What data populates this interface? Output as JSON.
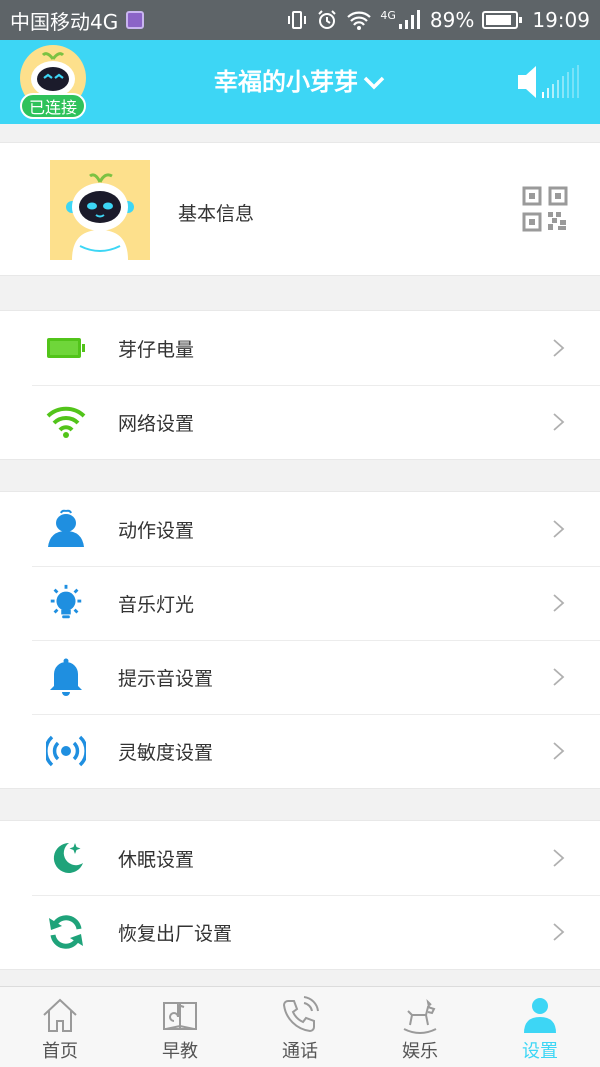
{
  "status_bar": {
    "carrier": "中国移动4G",
    "network": "4G",
    "battery_pct": "89%",
    "time": "19:09"
  },
  "header": {
    "connected_label": "已连接",
    "device_name": "幸福的小芽芽"
  },
  "profile": {
    "label": "基本信息"
  },
  "groups": [
    [
      {
        "label": "芽仔电量",
        "icon": "battery-icon",
        "color": "#52c41a"
      },
      {
        "label": "网络设置",
        "icon": "wifi-icon",
        "color": "#52c41a"
      }
    ],
    [
      {
        "label": "动作设置",
        "icon": "robot-action-icon",
        "color": "#1f8fe0"
      },
      {
        "label": "音乐灯光",
        "icon": "lightbulb-icon",
        "color": "#1f8fe0"
      },
      {
        "label": "提示音设置",
        "icon": "bell-icon",
        "color": "#1f8fe0"
      },
      {
        "label": "灵敏度设置",
        "icon": "sensitivity-icon",
        "color": "#1f8fe0"
      }
    ],
    [
      {
        "label": "休眠设置",
        "icon": "moon-icon",
        "color": "#1fa37a"
      },
      {
        "label": "恢复出厂设置",
        "icon": "refresh-icon",
        "color": "#1fa37a"
      }
    ]
  ],
  "tabs": [
    {
      "label": "首页",
      "icon": "home-icon",
      "active": false
    },
    {
      "label": "早教",
      "icon": "book-icon",
      "active": false
    },
    {
      "label": "通话",
      "icon": "phone-icon",
      "active": false
    },
    {
      "label": "娱乐",
      "icon": "rocking-horse-icon",
      "active": false
    },
    {
      "label": "设置",
      "icon": "person-settings-icon",
      "active": true
    }
  ],
  "colors": {
    "accent": "#3dd6f5",
    "connected": "#2fc25b",
    "green_icons": "#52c41a",
    "blue_icons": "#1f8fe0",
    "teal_icons": "#1fa37a"
  }
}
